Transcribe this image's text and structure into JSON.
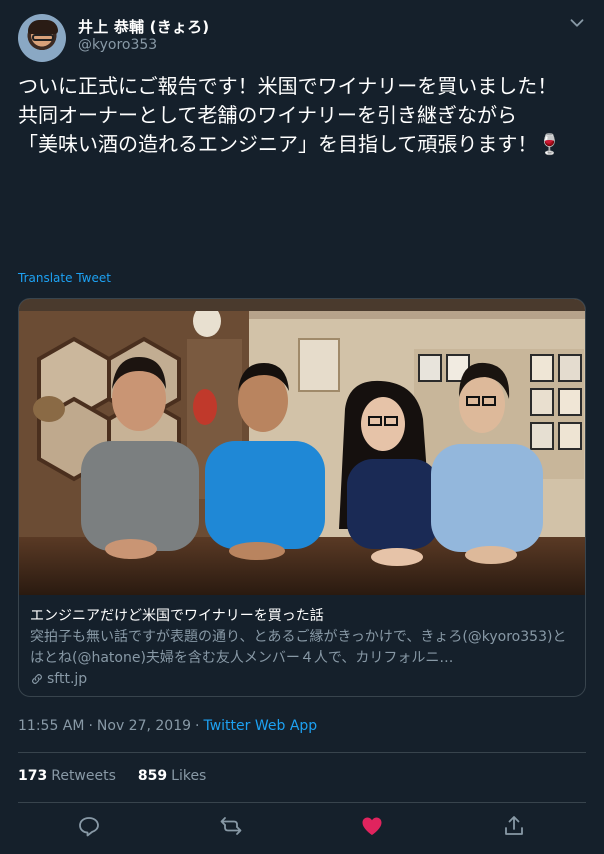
{
  "author": {
    "display_name": "井上 恭輔 (きょろ)",
    "handle": "@kyoro353"
  },
  "tweet": {
    "text": "ついに正式にご報告です！米国でワイナリーを買いました！\n共同オーナーとして老舗のワイナリーを引き継ぎながら\n「美味い酒の造れるエンジニア」を目指して頑張ります！🍷",
    "translate_label": "Translate Tweet"
  },
  "card": {
    "title": "エンジニアだけど米国でワイナリーを買った話",
    "description": "突拍子も無い話ですが表題の通り、とあるご縁がきっかけで、きょろ(@kyoro353)とはとね(@hatone)夫婦を含む友人メンバー４人で、カリフォルニ…",
    "domain": "sftt.jp"
  },
  "meta": {
    "time": "11:55 AM",
    "separator1": "·",
    "date": "Nov 27, 2019",
    "separator2": "·",
    "app": "Twitter Web App"
  },
  "stats": {
    "retweets_count": "173",
    "retweets_label": "Retweets",
    "likes_count": "859",
    "likes_label": "Likes"
  },
  "icons": {
    "menu": "chevron-down-icon",
    "link": "link-icon",
    "reply": "reply-icon",
    "retweet": "retweet-icon",
    "like": "heart-icon",
    "share": "share-icon"
  },
  "colors": {
    "background": "#15202b",
    "accent": "#1da1f2",
    "secondary_text": "#8899a6",
    "border": "#38444d",
    "like_active": "#e0245e"
  },
  "state": {
    "liked": true
  }
}
